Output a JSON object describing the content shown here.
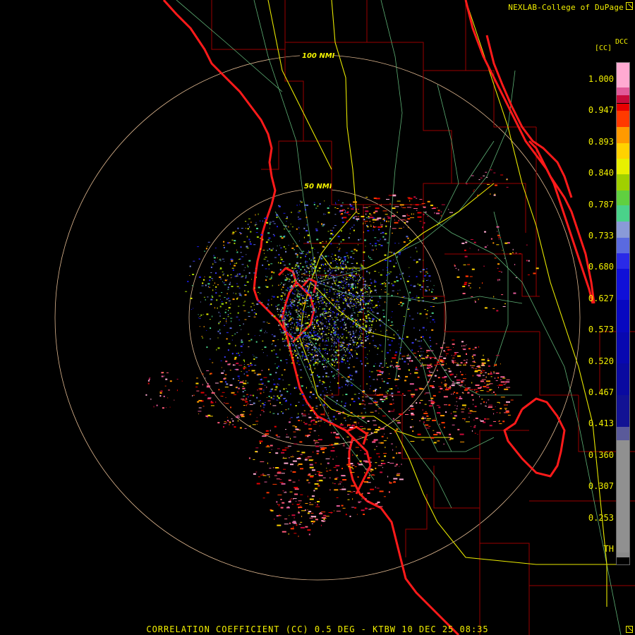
{
  "header": {
    "credit": "NEXLAB-College of DuPage",
    "product_code": "DCC",
    "units": "[CC]"
  },
  "map": {
    "radar_site": "KTBW",
    "range_rings": [
      {
        "range_nmi": 50,
        "label": "50 NMI"
      },
      {
        "range_nmi": 100,
        "label": "100 NMI"
      }
    ],
    "colors": {
      "background": "#000000",
      "coastline": "#ff1a1a",
      "county_lines": "#9a0000",
      "highways": "#e8e800",
      "roads": "#6fd08a",
      "range_ring": "#e0b890"
    }
  },
  "legend": {
    "labels": [
      "1.000",
      "0.947",
      "0.893",
      "0.840",
      "0.787",
      "0.733",
      "0.680",
      "0.627",
      "0.573",
      "0.520",
      "0.467",
      "0.413",
      "0.360",
      "0.307",
      "0.253",
      "TH"
    ],
    "scale": [
      {
        "min": 1.0,
        "color": "#ffaad2"
      },
      {
        "min": 0.987,
        "color": "#e25a9a"
      },
      {
        "min": 0.974,
        "color": "#c80a3a"
      },
      {
        "min": 0.96,
        "color": "#e80000"
      },
      {
        "min": 0.947,
        "color": "#ff3a00"
      },
      {
        "min": 0.92,
        "color": "#ff9a00"
      },
      {
        "min": 0.893,
        "color": "#ffd200"
      },
      {
        "min": 0.866,
        "color": "#e8f000"
      },
      {
        "min": 0.84,
        "color": "#a0d000"
      },
      {
        "min": 0.813,
        "color": "#60d040"
      },
      {
        "min": 0.787,
        "color": "#4ad28a"
      },
      {
        "min": 0.76,
        "color": "#8a9ad8"
      },
      {
        "min": 0.733,
        "color": "#5a6ae0"
      },
      {
        "min": 0.706,
        "color": "#2a2ae8"
      },
      {
        "min": 0.68,
        "color": "#1010d8"
      },
      {
        "min": 0.627,
        "color": "#0808c0"
      },
      {
        "min": 0.573,
        "color": "#0808b0"
      },
      {
        "min": 0.52,
        "color": "#0a0aa0"
      },
      {
        "min": 0.467,
        "color": "#121294"
      },
      {
        "min": 0.413,
        "color": "#5a5a9a"
      },
      {
        "min": 0.39,
        "color": "#909090"
      },
      {
        "min": 0.2,
        "color": "#8a8a8a"
      }
    ]
  },
  "footer": {
    "product": "CORRELATION COEFFICIENT (CC) 0.5 DEG - KTBW 10 DEC 25 08:35"
  }
}
